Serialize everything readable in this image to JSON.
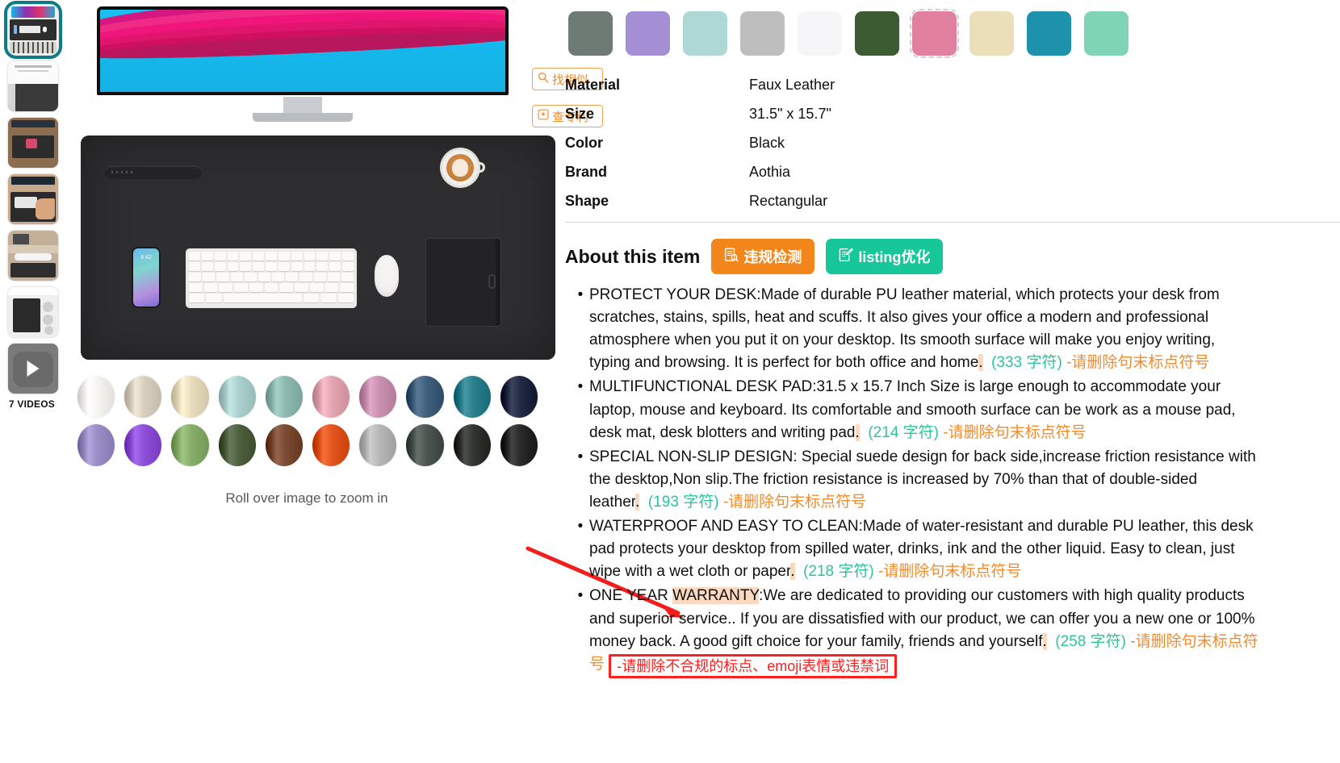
{
  "gallery": {
    "thumbnails": [
      {
        "name": "thumb-main-monitor-desk",
        "selected": true
      },
      {
        "name": "thumb-premium-pu-leather",
        "selected": false
      },
      {
        "name": "thumb-desk-scene",
        "selected": false
      },
      {
        "name": "thumb-hands-keyboard",
        "selected": false
      },
      {
        "name": "thumb-office-setup",
        "selected": false
      },
      {
        "name": "thumb-rolled-pad",
        "selected": false
      },
      {
        "name": "thumb-video-play",
        "selected": false
      }
    ],
    "videos_label": "7 VIDEOS",
    "roll_over_text": "Roll over image to zoom in",
    "share_icon": "share-icon",
    "phone_time": "8:42",
    "similar_button": {
      "label": "找相似",
      "icon": "search-icon"
    },
    "patent_button": {
      "label": "查专利",
      "icon": "patent-badge-icon"
    },
    "swatch_rows": [
      [
        "#f6f4f1",
        "#d8cec0",
        "#e6dcbc",
        "#aacfcd",
        "#8cb8b0",
        "#e2a3b0",
        "#c98fae",
        "#3f5f7d",
        "#2b7f8c",
        "#232a44"
      ],
      [
        "#9a8cc4",
        "#8c4fd6",
        "#86ad6a",
        "#4e6040",
        "#7a4a32",
        "#e0541e",
        "#b5b5b5",
        "#4d5550",
        "#32352f",
        "#2a2a2a"
      ]
    ]
  },
  "product": {
    "color_chips": [
      {
        "hex": "#6e7a74",
        "selected": false
      },
      {
        "hex": "#a58fd4",
        "selected": false
      },
      {
        "hex": "#aed8d6",
        "selected": false
      },
      {
        "hex": "#bebebe",
        "selected": false
      },
      {
        "hex": "#f6f5f7",
        "selected": false
      },
      {
        "hex": "#3d5b33",
        "selected": false
      },
      {
        "hex": "#e2819f",
        "selected": true
      },
      {
        "hex": "#eadfb9",
        "selected": false
      },
      {
        "hex": "#1e92ad",
        "selected": false
      },
      {
        "hex": "#7fd4b5",
        "selected": false
      }
    ],
    "attributes": [
      {
        "key": "Material",
        "value": "Faux Leather"
      },
      {
        "key": "Size",
        "value": "31.5\" x 15.7\""
      },
      {
        "key": "Color",
        "value": "Black"
      },
      {
        "key": "Brand",
        "value": "Aothia"
      },
      {
        "key": "Shape",
        "value": "Rectangular"
      }
    ]
  },
  "about": {
    "title": "About this item",
    "violation_button": {
      "label": "违规检测",
      "icon": "document-search-icon",
      "color": "#f2861b"
    },
    "listing_button": {
      "label": "listing优化",
      "icon": "edit-document-icon",
      "color": "#17c79a"
    },
    "bullets": [
      {
        "text_before": "PROTECT YOUR DESK:Made of durable PU leather material, which protects your desk from scratches, stains, spills, heat and scuffs. It also gives your office a modern and professional atmosphere when you put it on your desktop. Its smooth surface will make you enjoy writing, typing and browsing. It is perfect for both office and home",
        "highlight": ".",
        "count": "(333 字符)",
        "note": "-请删除句末标点符号"
      },
      {
        "text_before": "MULTIFUNCTIONAL DESK PAD:31.5 x 15.7 Inch Size is large enough to accommodate your laptop, mouse and keyboard. Its comfortable and smooth surface can be work as a mouse pad, desk mat, desk blotters and writing pad",
        "highlight": ".",
        "count": "(214 字符)",
        "note": "-请删除句末标点符号"
      },
      {
        "text_before": "SPECIAL NON-SLIP DESIGN: Special suede design for back side,increase friction resistance with the desktop,Non slip.The friction resistance is increased by 70% than that of double-sided leather",
        "highlight": ".",
        "count": "(193 字符)",
        "note": "-请删除句末标点符号"
      },
      {
        "text_before": "WATERPROOF AND EASY TO CLEAN:Made of water-resistant and durable PU leather, this desk pad protects your desktop from spilled water, drinks, ink and the other liquid. Easy to clean, just wipe with a wet cloth or paper",
        "highlight": ".",
        "count": "(218 字符)",
        "note": "-请删除句末标点符号"
      },
      {
        "text_start": "ONE YEAR ",
        "highlight_word": "WARRANTY",
        "text_before": ":We are dedicated to providing our customers with high quality products and superior service.. If you are dissatisfied with our product, we can offer you a new one or 100% money back. A good gift choice for your family, friends and yourself",
        "highlight": ".",
        "count": "(258 字符)",
        "note": "-请删除句末标点符号",
        "redbox": "-请删除不合规的标点、emoji表情或违禁词"
      }
    ]
  }
}
